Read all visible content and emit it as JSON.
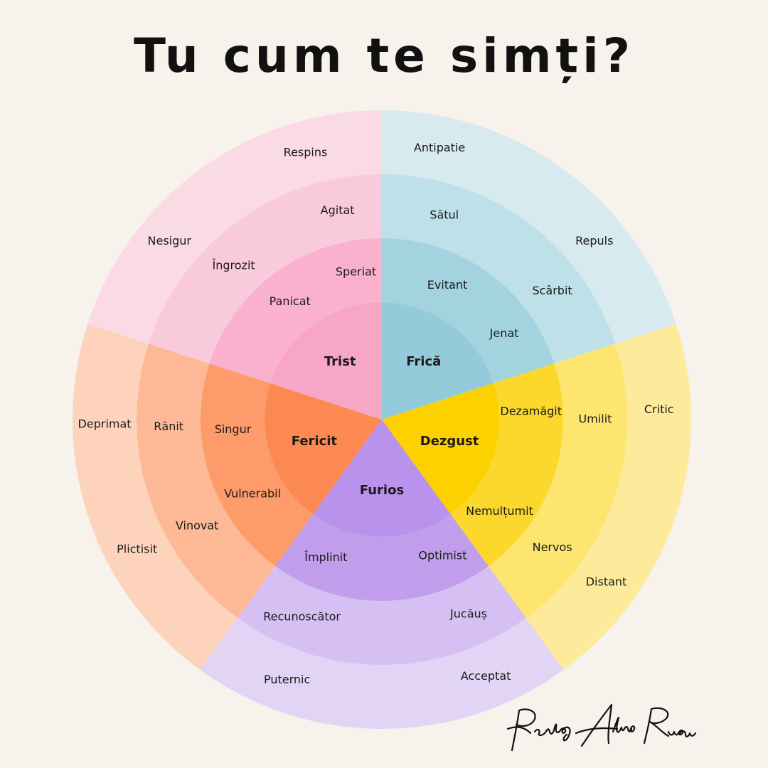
{
  "title": "Tu cum te simți?",
  "signature_text": "Psiholog Alina Rusu",
  "wheel": {
    "sectors": [
      {
        "id": "frica",
        "core": "Frică",
        "colors": [
          "#93cbda",
          "#a4d3e0",
          "#bde0e9",
          "#d6eaf0"
        ],
        "ring2": [
          "Speriat",
          "Panicat"
        ],
        "ring3": [
          "Agitat",
          "Îngrozit"
        ],
        "ring4": [
          "Respins",
          "Nesigur"
        ]
      },
      {
        "id": "dezgust",
        "core": "Dezgust",
        "colors": [
          "#fdd000",
          "#fdd82c",
          "#fde570",
          "#fdeb9b"
        ],
        "ring2": [
          "Evitant",
          "Jenat"
        ],
        "ring3": [
          "Sătul",
          "Scârbit"
        ],
        "ring4": [
          "Antipatie",
          "Repuls"
        ]
      },
      {
        "id": "furios",
        "core": "Furios",
        "colors": [
          "#b992eb",
          "#c09eec",
          "#d6bff2",
          "#e2d4f4"
        ],
        "ring2": [
          "Dezamăgit",
          "Nemulțumit"
        ],
        "ring3": [
          "Umilit",
          "Nervos"
        ],
        "ring4": [
          "Critic",
          "Distant"
        ]
      },
      {
        "id": "fericit",
        "core": "Fericit",
        "colors": [
          "#fc8952",
          "#fd9b6a",
          "#fdb996",
          "#fdd3bc"
        ],
        "ring2": [
          "Optimist",
          "Împlinit"
        ],
        "ring3": [
          "Jucăuș",
          "Recunoscător"
        ],
        "ring4": [
          "Acceptat",
          "Puternic"
        ]
      },
      {
        "id": "trist",
        "core": "Trist",
        "colors": [
          "#f8a6c6",
          "#f9b1cd",
          "#f9cadc",
          "#fadae5"
        ],
        "ring2": [
          "Vulnerabil",
          "Singur"
        ],
        "ring3": [
          "Vinovat",
          "Rănit"
        ],
        "ring4": [
          "Plictisit",
          "Deprimat"
        ]
      }
    ]
  }
}
